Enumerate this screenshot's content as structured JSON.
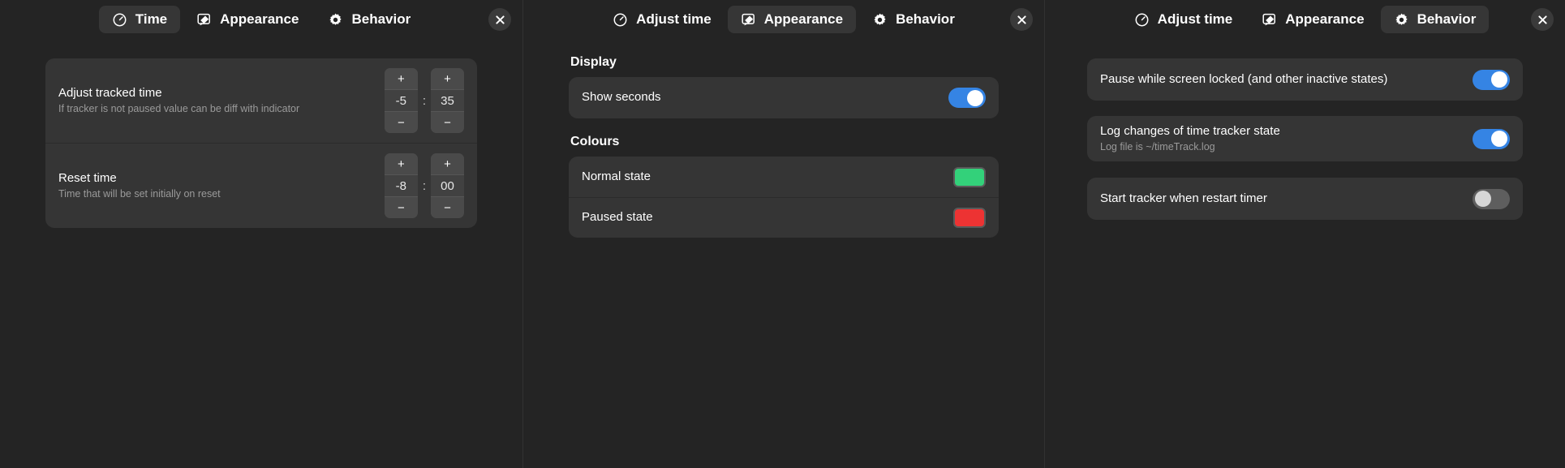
{
  "colors": {
    "accent_on": "#3584e4",
    "toggle_off": "#5e5e5e",
    "panel_bg": "#242424",
    "card_bg": "#353535",
    "normal_state_color": "#33d17a",
    "paused_state_color": "#ed3333"
  },
  "panel_time": {
    "tabs": [
      {
        "label": "Time",
        "icon": "clock-icon",
        "active": true
      },
      {
        "label": "Appearance",
        "icon": "paintbrush-icon",
        "active": false
      },
      {
        "label": "Behavior",
        "icon": "gear-icon",
        "active": false
      }
    ],
    "close_label": "×",
    "rows": [
      {
        "title": "Adjust tracked time",
        "subtitle": "If tracker is not paused value can be diff with indicator",
        "hours": "-5",
        "separator": ":",
        "minutes": "35",
        "plus": "+",
        "minus": "−"
      },
      {
        "title": "Reset time",
        "subtitle": "Time that will be set initially on reset",
        "hours": "-8",
        "separator": ":",
        "minutes": "00",
        "plus": "+",
        "minus": "−"
      }
    ]
  },
  "panel_appearance": {
    "tabs": [
      {
        "label": "Adjust time",
        "icon": "clock-icon",
        "active": false
      },
      {
        "label": "Appearance",
        "icon": "paintbrush-icon",
        "active": true
      },
      {
        "label": "Behavior",
        "icon": "gear-icon",
        "active": false
      }
    ],
    "close_label": "×",
    "display_section_title": "Display",
    "display_rows": [
      {
        "title": "Show seconds",
        "toggle": "on"
      }
    ],
    "colours_section_title": "Colours",
    "colour_rows": [
      {
        "title": "Normal state",
        "color": "#33d17a"
      },
      {
        "title": "Paused state",
        "color": "#ed3333"
      }
    ]
  },
  "panel_behavior": {
    "tabs": [
      {
        "label": "Adjust time",
        "icon": "clock-icon",
        "active": false
      },
      {
        "label": "Appearance",
        "icon": "paintbrush-icon",
        "active": false
      },
      {
        "label": "Behavior",
        "icon": "gear-icon",
        "active": true
      }
    ],
    "close_label": "×",
    "rows": [
      {
        "title": "Pause while screen locked (and other inactive states)",
        "subtitle": "",
        "toggle": "on"
      },
      {
        "title": "Log changes of time tracker state",
        "subtitle": "Log file is ~/timeTrack.log",
        "toggle": "on"
      },
      {
        "title": "Start tracker when restart timer",
        "subtitle": "",
        "toggle": "off"
      }
    ]
  }
}
